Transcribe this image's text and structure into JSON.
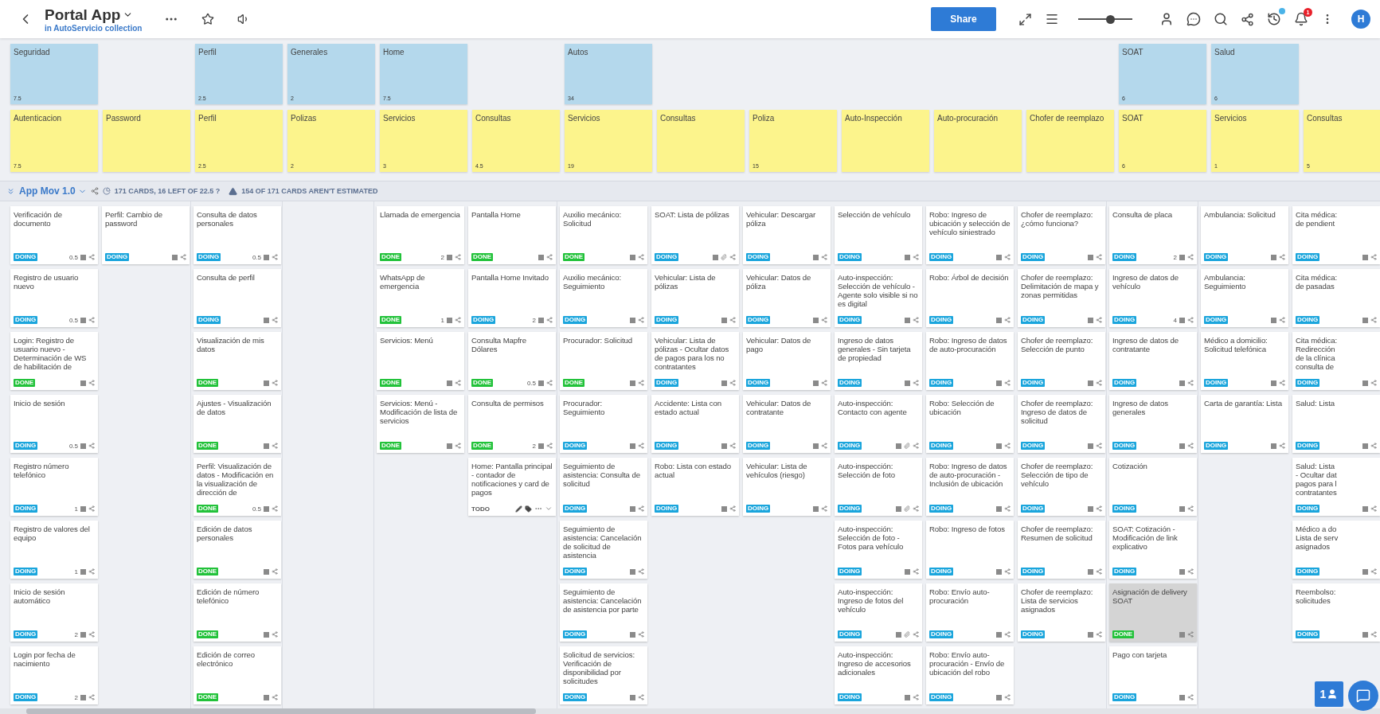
{
  "header": {
    "title": "Portal App",
    "subtitle": "in AutoServicio collection",
    "share": "Share",
    "zoom": {
      "level": 0.6
    },
    "notifications": "1",
    "avatar": "H"
  },
  "release": {
    "title": "App Mov 1.0",
    "stats": "171 CARDS, 16 LEFT OF 22.5 ?",
    "warning": "154 OF 171 CARDS AREN'T ESTIMATED"
  },
  "columns": [
    {
      "activity": {
        "title": "Seguridad",
        "estimate": "7.5"
      },
      "step": {
        "title": "Autenticacion",
        "estimate": "7.5"
      },
      "cards": [
        {
          "title": "Verificación de documento",
          "badge": "DOING",
          "kind": "doing",
          "estimate": "0.5",
          "selected": false,
          "hovered": false
        },
        {
          "title": "Registro de usuario nuevo",
          "badge": "DOING",
          "kind": "doing",
          "estimate": "0.5",
          "selected": false,
          "hovered": false
        },
        {
          "title": "Login: Registro de usuario nuevo - Determinación de WS de habilitación de",
          "badge": "DONE",
          "kind": "done",
          "selected": false,
          "hovered": false
        },
        {
          "title": "Inicio de sesión",
          "badge": "DOING",
          "kind": "doing",
          "estimate": "0.5",
          "selected": false,
          "hovered": false
        },
        {
          "title": "Registro número telefónico",
          "badge": "DOING",
          "kind": "doing",
          "estimate": "1",
          "selected": false,
          "hovered": false
        },
        {
          "title": "Registro de valores del equipo",
          "badge": "DOING",
          "kind": "doing",
          "estimate": "1",
          "selected": false,
          "hovered": false
        },
        {
          "title": "Inicio de sesión automático",
          "badge": "DOING",
          "kind": "doing",
          "estimate": "2",
          "selected": false,
          "hovered": false
        },
        {
          "title": "Login por fecha de nacimiento",
          "badge": "DOING",
          "kind": "doing",
          "estimate": "2",
          "selected": false,
          "hovered": false
        }
      ]
    },
    {
      "step": {
        "title": "Password"
      },
      "cards": [
        {
          "title": "Perfil: Cambio de password",
          "badge": "DOING",
          "kind": "doing",
          "selected": false,
          "hovered": false
        }
      ]
    },
    {
      "activity": {
        "title": "Perfil",
        "estimate": "2.5"
      },
      "step": {
        "title": "Perfil",
        "estimate": "2.5"
      },
      "cards": [
        {
          "title": "Consulta de datos personales",
          "badge": "DOING",
          "kind": "doing",
          "estimate": "0.5",
          "selected": false,
          "hovered": false
        },
        {
          "title": "Consulta de perfil",
          "badge": "DOING",
          "kind": "doing",
          "selected": false,
          "hovered": false
        },
        {
          "title": "Visualización de mis datos",
          "badge": "DONE",
          "kind": "done",
          "selected": false,
          "hovered": false
        },
        {
          "title": "Ajustes - Visualización de datos",
          "badge": "DONE",
          "kind": "done",
          "selected": false,
          "hovered": false
        },
        {
          "title": "Perfil: Visualización de datos - Modificación en la visualización de dirección de",
          "badge": "DONE",
          "kind": "done",
          "estimate": "0.5",
          "selected": false,
          "hovered": false
        },
        {
          "title": "Edición de datos personales",
          "badge": "DONE",
          "kind": "done",
          "selected": false,
          "hovered": false
        },
        {
          "title": "Edición de número telefónico",
          "badge": "DONE",
          "kind": "done",
          "selected": false,
          "hovered": false
        },
        {
          "title": "Edición de correo electrónico",
          "badge": "DONE",
          "kind": "done",
          "selected": false,
          "hovered": false
        }
      ]
    },
    {
      "activity": {
        "title": "Generales",
        "estimate": "2"
      },
      "step": {
        "title": "Polizas",
        "estimate": "2"
      }
    },
    {
      "activity": {
        "title": "Home",
        "estimate": "7.5"
      },
      "step": {
        "title": "Servicios",
        "estimate": "3"
      },
      "cards": [
        {
          "title": "Llamada de emergencia",
          "badge": "DONE",
          "kind": "done",
          "estimate": "2",
          "selected": false,
          "hovered": false
        },
        {
          "title": "WhatsApp de emergencia",
          "badge": "DONE",
          "kind": "done",
          "estimate": "1",
          "selected": false,
          "hovered": false
        },
        {
          "title": "Servicios: Menú",
          "badge": "DONE",
          "kind": "done",
          "selected": false,
          "hovered": false
        },
        {
          "title": "Servicios: Menú - Modificación de lista de servicios",
          "badge": "DONE",
          "kind": "done",
          "selected": false,
          "hovered": false
        }
      ]
    },
    {
      "step": {
        "title": "Consultas",
        "estimate": "4.5"
      },
      "cards": [
        {
          "title": "Pantalla Home",
          "badge": "DONE",
          "kind": "done",
          "selected": false,
          "hovered": false
        },
        {
          "title": "Pantalla Home Invitado",
          "badge": "DOING",
          "kind": "doing",
          "estimate": "2",
          "selected": false,
          "hovered": false
        },
        {
          "title": "Consulta Mapfre Dólares",
          "badge": "DONE",
          "kind": "done",
          "estimate": "0.5",
          "selected": false,
          "hovered": false
        },
        {
          "title": "Consulta de permisos",
          "badge": "DONE",
          "kind": "done",
          "estimate": "2",
          "selected": false,
          "hovered": false
        },
        {
          "title": "Home: Pantalla principal - contador de notificaciones y card de pagos",
          "badge": "TODO",
          "kind": "todo",
          "selected": false,
          "hovered": true
        }
      ]
    },
    {
      "activity": {
        "title": "Autos",
        "estimate": "34"
      },
      "step": {
        "title": "Servicios",
        "estimate": "19"
      },
      "cards": [
        {
          "title": "Auxilio mecánico: Solicitud",
          "badge": "DONE",
          "kind": "done",
          "selected": false,
          "hovered": false
        },
        {
          "title": "Auxilio mecánico: Seguimiento",
          "badge": "DOING",
          "kind": "doing",
          "selected": false,
          "hovered": false
        },
        {
          "title": "Procurador: Solicitud",
          "badge": "DONE",
          "kind": "done",
          "selected": false,
          "hovered": false
        },
        {
          "title": "Procurador: Seguimiento",
          "badge": "DOING",
          "kind": "doing",
          "selected": false,
          "hovered": false
        },
        {
          "title": "Seguimiento de asistencia: Consulta de solicitud",
          "badge": "DOING",
          "kind": "doing",
          "selected": false,
          "hovered": false
        },
        {
          "title": "Seguimiento de asistencia: Cancelación de solicitud de asistencia",
          "badge": "DOING",
          "kind": "doing",
          "selected": false,
          "hovered": false
        },
        {
          "title": "Seguimiento de asistencia: Cancelación de asistencia por parte",
          "badge": "DOING",
          "kind": "doing",
          "selected": false,
          "hovered": false
        },
        {
          "title": "Solicitud de servicios: Verificación de disponibilidad por solicitudes",
          "badge": "DOING",
          "kind": "doing",
          "selected": false,
          "hovered": false
        }
      ]
    },
    {
      "step": {
        "title": "Consultas"
      },
      "cards": [
        {
          "title": "SOAT: Lista de pólizas",
          "badge": "DOING",
          "kind": "doing",
          "attachment": true,
          "selected": false,
          "hovered": false
        },
        {
          "title": "Vehicular: Lista de pólizas",
          "badge": "DOING",
          "kind": "doing",
          "selected": false,
          "hovered": false
        },
        {
          "title": "Vehicular: Lista de pólizas - Ocultar datos de pagos para los no contratantes",
          "badge": "DOING",
          "kind": "doing",
          "selected": false,
          "hovered": false
        },
        {
          "title": "Accidente: Lista con estado actual",
          "badge": "DOING",
          "kind": "doing",
          "selected": false,
          "hovered": false
        },
        {
          "title": "Robo: Lista con estado actual",
          "badge": "DOING",
          "kind": "doing",
          "selected": false,
          "hovered": false
        }
      ]
    },
    {
      "step": {
        "title": "Poliza",
        "estimate": "15"
      },
      "cards": [
        {
          "title": "Vehicular: Descargar póliza",
          "badge": "DOING",
          "kind": "doing",
          "selected": false,
          "hovered": false
        },
        {
          "title": "Vehicular: Datos de póliza",
          "badge": "DOING",
          "kind": "doing",
          "selected": false,
          "hovered": false
        },
        {
          "title": "Vehicular: Datos de pago",
          "badge": "DOING",
          "kind": "doing",
          "selected": false,
          "hovered": false
        },
        {
          "title": "Vehicular: Datos de contratante",
          "badge": "DOING",
          "kind": "doing",
          "selected": false,
          "hovered": false
        },
        {
          "title": "Vehicular: Lista de vehículos (riesgo)",
          "badge": "DOING",
          "kind": "doing",
          "selected": false,
          "hovered": false
        }
      ]
    },
    {
      "step": {
        "title": "Auto-Inspección"
      },
      "cards": [
        {
          "title": "Selección de vehículo",
          "badge": "DOING",
          "kind": "doing",
          "selected": false,
          "hovered": false
        },
        {
          "title": "Auto-inspección: Selección de vehículo - Agente solo visible si no es digital",
          "badge": "DOING",
          "kind": "doing",
          "selected": false,
          "hovered": false
        },
        {
          "title": "Ingreso de datos generales - Sin tarjeta de propiedad",
          "badge": "DOING",
          "kind": "doing",
          "selected": false,
          "hovered": false
        },
        {
          "title": "Auto-inspección: Contacto con agente",
          "badge": "DOING",
          "kind": "doing",
          "attachment": true,
          "selected": false,
          "hovered": false
        },
        {
          "title": "Auto-inspección: Selección de foto",
          "badge": "DOING",
          "kind": "doing",
          "attachment": true,
          "selected": false,
          "hovered": false
        },
        {
          "title": "Auto-inspección: Selección de foto - Fotos para vehículo",
          "badge": "DOING",
          "kind": "doing",
          "selected": false,
          "hovered": false
        },
        {
          "title": "Auto-inspección: Ingreso de fotos del vehículo",
          "badge": "DOING",
          "kind": "doing",
          "attachment": true,
          "selected": false,
          "hovered": false
        },
        {
          "title": "Auto-inspección: Ingreso de accesorios adicionales",
          "badge": "DOING",
          "kind": "doing",
          "selected": false,
          "hovered": false
        }
      ]
    },
    {
      "step": {
        "title": "Auto-procuración"
      },
      "cards": [
        {
          "title": "Robo: Ingreso de ubicación y selección de vehículo siniestrado",
          "badge": "DOING",
          "kind": "doing",
          "selected": false,
          "hovered": false
        },
        {
          "title": "Robo: Árbol de decisión",
          "badge": "DOING",
          "kind": "doing",
          "selected": false,
          "hovered": false
        },
        {
          "title": "Robo: Ingreso de datos de auto-procuración",
          "badge": "DOING",
          "kind": "doing",
          "selected": false,
          "hovered": false
        },
        {
          "title": "Robo: Selección de ubicación",
          "badge": "DOING",
          "kind": "doing",
          "selected": false,
          "hovered": false
        },
        {
          "title": "Robo: Ingreso de datos de auto-procuración - Inclusión de ubicación",
          "badge": "DOING",
          "kind": "doing",
          "selected": false,
          "hovered": false
        },
        {
          "title": "Robo: Ingreso de fotos",
          "badge": "DOING",
          "kind": "doing",
          "selected": false,
          "hovered": false
        },
        {
          "title": "Robo: Envío auto-procuración",
          "badge": "DOING",
          "kind": "doing",
          "selected": false,
          "hovered": false
        },
        {
          "title": "Robo: Envío auto-procuración - Envío de ubicación del robo",
          "badge": "DOING",
          "kind": "doing",
          "selected": false,
          "hovered": false
        }
      ]
    },
    {
      "step": {
        "title": "Chofer de reemplazo"
      },
      "cards": [
        {
          "title": "Chofer de reemplazo: ¿cómo funciona?",
          "badge": "DOING",
          "kind": "doing",
          "selected": false,
          "hovered": false
        },
        {
          "title": "Chofer de reemplazo: Delimitación de mapa y zonas permitidas",
          "badge": "DOING",
          "kind": "doing",
          "selected": false,
          "hovered": false
        },
        {
          "title": "Chofer de reemplazo: Selección de punto",
          "badge": "DOING",
          "kind": "doing",
          "selected": false,
          "hovered": false
        },
        {
          "title": "Chofer de reemplazo: Ingreso de datos de solicitud",
          "badge": "DOING",
          "kind": "doing",
          "selected": false,
          "hovered": false
        },
        {
          "title": "Chofer de reemplazo: Selección de tipo de vehículo",
          "badge": "DOING",
          "kind": "doing",
          "selected": false,
          "hovered": false
        },
        {
          "title": "Chofer de reemplazo: Resumen de solicitud",
          "badge": "DOING",
          "kind": "doing",
          "selected": false,
          "hovered": false
        },
        {
          "title": "Chofer de reemplazo: Lista de servicios asignados",
          "badge": "DOING",
          "kind": "doing",
          "selected": false,
          "hovered": false
        }
      ]
    },
    {
      "activity": {
        "title": "SOAT",
        "estimate": "6"
      },
      "step": {
        "title": "SOAT",
        "estimate": "6"
      },
      "cards": [
        {
          "title": "Consulta de placa",
          "badge": "DOING",
          "kind": "doing",
          "estimate": "2",
          "selected": false,
          "hovered": false
        },
        {
          "title": "Ingreso de datos de vehículo",
          "badge": "DOING",
          "kind": "doing",
          "estimate": "4",
          "selected": false,
          "hovered": false
        },
        {
          "title": "Ingreso de datos de contratante",
          "badge": "DOING",
          "kind": "doing",
          "selected": false,
          "hovered": false
        },
        {
          "title": "Ingreso de datos generales",
          "badge": "DOING",
          "kind": "doing",
          "selected": false,
          "hovered": false
        },
        {
          "title": "Cotización",
          "badge": "DOING",
          "kind": "doing",
          "selected": false,
          "hovered": false
        },
        {
          "title": "SOAT: Cotización - Modificación de link explicativo",
          "badge": "DOING",
          "kind": "doing",
          "selected": false,
          "hovered": false
        },
        {
          "title": "Asignación de delivery SOAT",
          "badge": "DONE",
          "kind": "done",
          "selected": true,
          "hovered": false
        },
        {
          "title": "Pago con tarjeta",
          "badge": "DOING",
          "kind": "doing",
          "selected": false,
          "hovered": false
        }
      ]
    },
    {
      "activity": {
        "title": "Salud",
        "estimate": "6"
      },
      "step": {
        "title": "Servicios",
        "estimate": "1"
      },
      "cards": [
        {
          "title": "Ambulancia: Solicitud",
          "badge": "DOING",
          "kind": "doing",
          "selected": false,
          "hovered": false
        },
        {
          "title": "Ambulancia: Seguimiento",
          "badge": "DOING",
          "kind": "doing",
          "selected": false,
          "hovered": false
        },
        {
          "title": "Médico a domicilio: Solicitud telefónica",
          "badge": "DOING",
          "kind": "doing",
          "selected": false,
          "hovered": false
        },
        {
          "title": "Carta de garantía: Lista",
          "badge": "DOING",
          "kind": "doing",
          "selected": false,
          "hovered": false
        }
      ]
    },
    {
      "step": {
        "title": "Consultas",
        "estimate": "5"
      },
      "cards": [
        {
          "title": "Cita médica:\nde pendient",
          "badge": "DOING",
          "kind": "doing",
          "selected": false,
          "hovered": false
        },
        {
          "title": "Cita médica:\nde pasadas",
          "badge": "DOING",
          "kind": "doing",
          "selected": false,
          "hovered": false
        },
        {
          "title": "Cita médica:\nRedirección\nde la clínica\nconsulta de",
          "badge": "DOING",
          "kind": "doing",
          "selected": false,
          "hovered": false
        },
        {
          "title": "Salud: Lista",
          "badge": "DOING",
          "kind": "doing",
          "selected": false,
          "hovered": false
        },
        {
          "title": "Salud: Lista\n- Ocultar dat\npagos para l\ncontratantes",
          "badge": "DOING",
          "kind": "doing",
          "selected": false,
          "hovered": false
        },
        {
          "title": "Médico a do\nLista de serv\nasignados",
          "badge": "DOING",
          "kind": "doing",
          "selected": false,
          "hovered": false
        },
        {
          "title": "Reembolso:\nsolicitudes",
          "badge": "DOING",
          "kind": "doing",
          "selected": false,
          "hovered": false
        }
      ]
    }
  ],
  "floating": {
    "count": "1"
  }
}
